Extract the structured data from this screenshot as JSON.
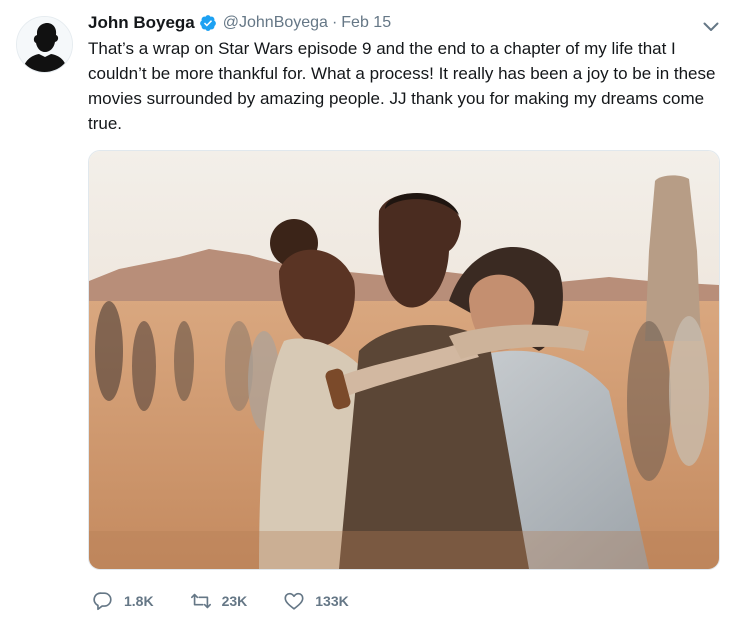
{
  "tweet": {
    "author": {
      "display_name": "John Boyega",
      "handle": "@JohnBoyega",
      "verified": true,
      "avatar_icon": "silhouette-avatar"
    },
    "separator": "·",
    "date": "Feb 15",
    "text": "That’s a wrap on Star Wars episode 9 and the end to a chapter of my life that I couldn’t be more thankful for. What a process! It really has been a joy to be in these movies surrounded by amazing people. JJ thank you for making my dreams come true.",
    "menu_icon": "chevron-down-icon",
    "media": {
      "kind": "photo"
    },
    "actions": {
      "reply": {
        "icon": "reply-icon",
        "count": "1.8K"
      },
      "retweet": {
        "icon": "retweet-icon",
        "count": "23K"
      },
      "like": {
        "icon": "heart-icon",
        "count": "133K"
      }
    }
  },
  "colors": {
    "text_primary": "#14171a",
    "text_secondary": "#657786",
    "verified_blue": "#1da1f2",
    "border": "#e1e8ed"
  }
}
